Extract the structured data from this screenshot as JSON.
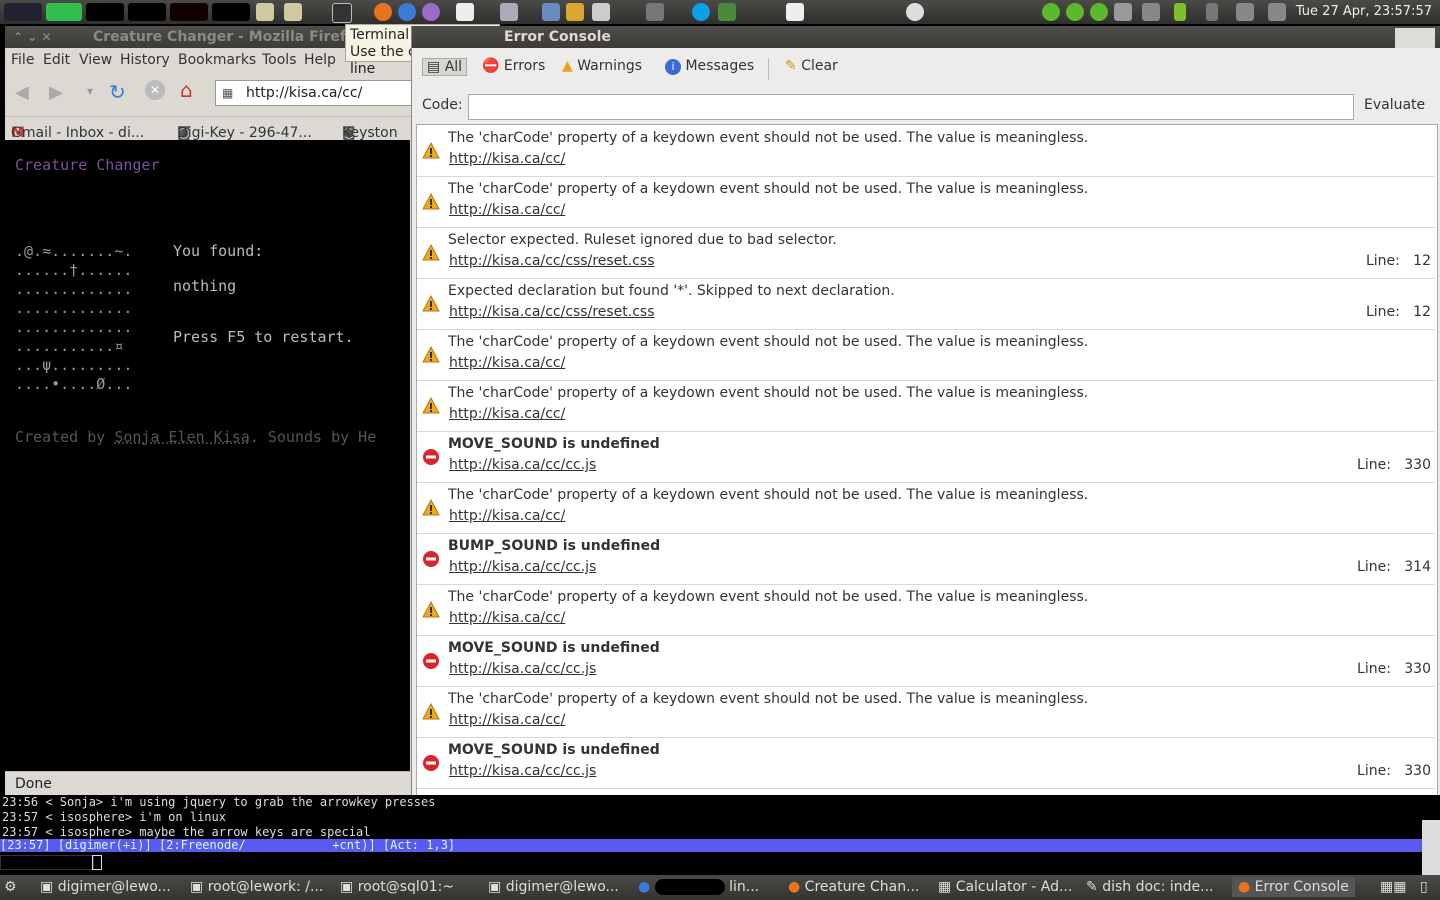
{
  "top_panel": {
    "clock": "Tue 27 Apr, 23:57:57"
  },
  "tooltip": {
    "line1": "Terminal",
    "line2": "Use the command line"
  },
  "firefox": {
    "title": "Creature Changer - Mozilla Firefox",
    "menu": [
      "File",
      "Edit",
      "View",
      "History",
      "Bookmarks",
      "Tools",
      "Help"
    ],
    "url": "http://kisa.ca/cc/",
    "bookmarks": [
      "Gmail - Inbox - di...",
      "Digi-Key - 296-47...",
      "Keyston"
    ],
    "page": {
      "heading": "Creature Changer",
      "grid": [
        ".@.≈.......~.",
        "......†......",
        ".............",
        ".............",
        ".............",
        "...........¤",
        "...ψ.........",
        "....•....Ø..."
      ],
      "found_label": "You found:",
      "found_value": "nothing",
      "restart": "Press F5 to restart.",
      "credit_prefix": "Created by",
      "credit_name": "Sonja Elen Kisa",
      "credit_suffix": ". Sounds by He"
    },
    "status": "Done"
  },
  "error_console": {
    "title": "Error Console",
    "toolbar": {
      "all": "All",
      "errors": "Errors",
      "warnings": "Warnings",
      "messages": "Messages",
      "clear": "Clear"
    },
    "code_label": "Code:",
    "evaluate": "Evaluate",
    "entries": [
      {
        "type": "warning",
        "message": "The 'charCode' property of a keydown event should not be used. The value is meaningless.",
        "source": "http://kisa.ca/cc/",
        "line": ""
      },
      {
        "type": "warning",
        "message": "The 'charCode' property of a keydown event should not be used. The value is meaningless.",
        "source": "http://kisa.ca/cc/",
        "line": ""
      },
      {
        "type": "warning",
        "message": "Selector expected.  Ruleset ignored due to bad selector.",
        "source": "http://kisa.ca/cc/css/reset.css",
        "line": "Line:   12"
      },
      {
        "type": "warning",
        "message": "Expected declaration but found '*'.  Skipped to next declaration.",
        "source": "http://kisa.ca/cc/css/reset.css",
        "line": "Line:   12"
      },
      {
        "type": "warning",
        "message": "The 'charCode' property of a keydown event should not be used. The value is meaningless.",
        "source": "http://kisa.ca/cc/",
        "line": ""
      },
      {
        "type": "warning",
        "message": "The 'charCode' property of a keydown event should not be used. The value is meaningless.",
        "source": "http://kisa.ca/cc/",
        "line": ""
      },
      {
        "type": "error",
        "message": "MOVE_SOUND is undefined",
        "source": "http://kisa.ca/cc/cc.js",
        "line": "Line:   330"
      },
      {
        "type": "warning",
        "message": "The 'charCode' property of a keydown event should not be used. The value is meaningless.",
        "source": "http://kisa.ca/cc/",
        "line": ""
      },
      {
        "type": "error",
        "message": "BUMP_SOUND is undefined",
        "source": "http://kisa.ca/cc/cc.js",
        "line": "Line:   314"
      },
      {
        "type": "warning",
        "message": "The 'charCode' property of a keydown event should not be used. The value is meaningless.",
        "source": "http://kisa.ca/cc/",
        "line": ""
      },
      {
        "type": "error",
        "message": "MOVE_SOUND is undefined",
        "source": "http://kisa.ca/cc/cc.js",
        "line": "Line:   330"
      },
      {
        "type": "warning",
        "message": "The 'charCode' property of a keydown event should not be used. The value is meaningless.",
        "source": "http://kisa.ca/cc/",
        "line": ""
      },
      {
        "type": "error",
        "message": "MOVE_SOUND is undefined",
        "source": "http://kisa.ca/cc/cc.js",
        "line": "Line:   330"
      }
    ]
  },
  "irssi": {
    "lines": [
      "23:56 < Sonja> i'm using jquery to grab the arrowkey presses",
      "23:57 < isosphere> i'm on linux",
      "23:57 < isosphere> maybe the arrow keys are special"
    ],
    "status": "[23:57] [digimer(+i)] [2:Freenode/            +cnt)] [Act: 1,3]"
  },
  "taskbar": {
    "items": [
      "digimer@lewo...",
      "root@lework: /...",
      "root@sql01:~",
      "digimer@lewo...",
      "lin...",
      "Creature Chan...",
      "Calculator - Ad...",
      "dish doc: inde...",
      "Error Console"
    ]
  }
}
